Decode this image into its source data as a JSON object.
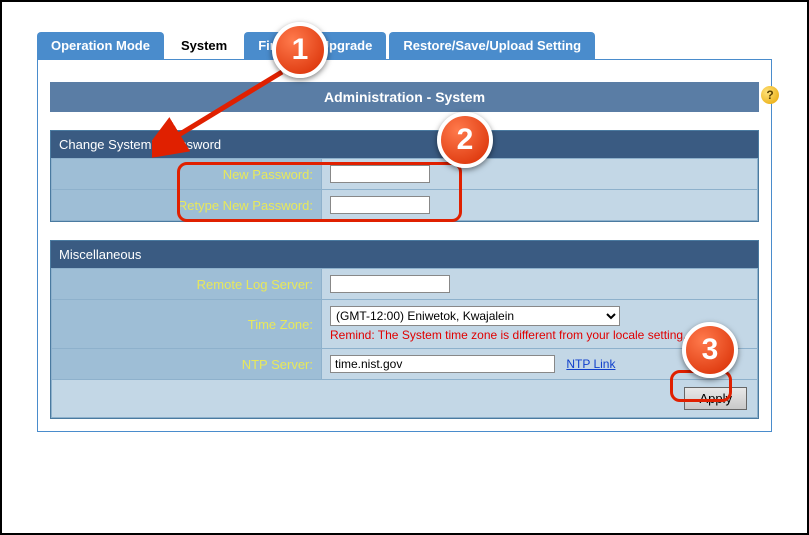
{
  "tabs": {
    "operation_mode": "Operation Mode",
    "system": "System",
    "firmware": "Firmware Upgrade",
    "restore": "Restore/Save/Upload Setting"
  },
  "page_title": "Administration - System",
  "help_icon": "?",
  "sections": {
    "password": {
      "header": "Change System's Password",
      "new_password_label": "New Password:",
      "new_password_value": "",
      "retype_label": "Retype New Password:",
      "retype_value": ""
    },
    "misc": {
      "header": "Miscellaneous",
      "remote_log_label": "Remote Log Server:",
      "remote_log_value": "",
      "timezone_label": "Time Zone:",
      "timezone_value": "(GMT-12:00) Eniwetok, Kwajalein",
      "timezone_remind": "Remind: The System time zone is different from your locale setting.",
      "ntp_label": "NTP Server:",
      "ntp_value": "time.nist.gov",
      "ntp_link": "NTP Link"
    }
  },
  "apply_label": "Apply",
  "annotations": {
    "c1": "1",
    "c2": "2",
    "c3": "3"
  }
}
